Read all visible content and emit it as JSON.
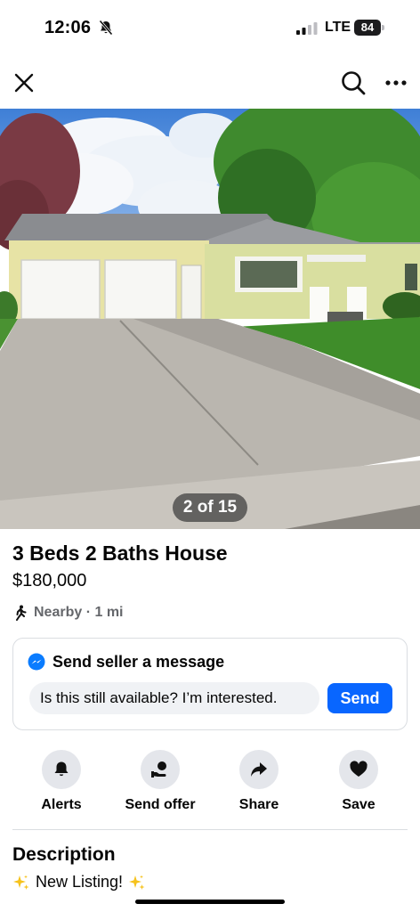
{
  "status": {
    "time": "12:06",
    "network": "LTE",
    "battery": "84"
  },
  "nav": {
    "close_icon": "close-icon",
    "search_icon": "search-icon",
    "more_icon": "more-horizontal-icon"
  },
  "photo": {
    "counter": "2 of 15",
    "subject": "house-photo"
  },
  "listing": {
    "title": "3 Beds 2 Baths House",
    "price": "$180,000",
    "location": "Nearby · 1 mi"
  },
  "message": {
    "title": "Send seller a message",
    "input_value": "Is this still available? I’m interested.",
    "send_label": "Send"
  },
  "actions": [
    {
      "label": "Alerts",
      "icon": "bell-icon"
    },
    {
      "label": "Send offer",
      "icon": "offer-icon"
    },
    {
      "label": "Share",
      "icon": "share-icon"
    },
    {
      "label": "Save",
      "icon": "heart-icon"
    }
  ],
  "description": {
    "heading": "Description",
    "text": "New Listing!"
  },
  "colors": {
    "accent": "#0866ff",
    "text": "#050505",
    "secondary": "#65676b",
    "chip": "#e4e6eb"
  }
}
